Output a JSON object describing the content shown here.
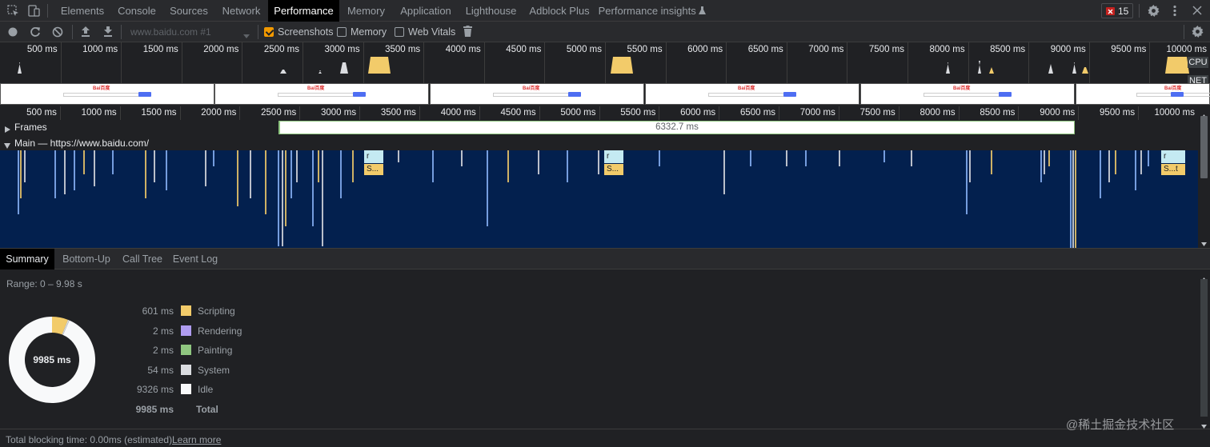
{
  "tabs": [
    "Elements",
    "Console",
    "Sources",
    "Network",
    "Performance",
    "Memory",
    "Application",
    "Lighthouse",
    "Adblock Plus",
    "Performance insights"
  ],
  "active_tab": "Performance",
  "error_count": "15",
  "toolbar": {
    "target": "www.baidu.com #1",
    "screenshots_label": "Screenshots",
    "memory_label": "Memory",
    "webvitals_label": "Web Vitals",
    "screenshots_checked": true
  },
  "overview": {
    "ticks": [
      "500 ms",
      "1000 ms",
      "1500 ms",
      "2000 ms",
      "2500 ms",
      "3000 ms",
      "3500 ms",
      "4000 ms",
      "4500 ms",
      "5000 ms",
      "5500 ms",
      "6000 ms",
      "6500 ms",
      "7000 ms",
      "7500 ms",
      "8000 ms",
      "8500 ms",
      "9000 ms",
      "9500 ms",
      "10000 ms"
    ],
    "cpu_label": "CPU",
    "net_label": "NET",
    "screenshot_logo": "Bai百度"
  },
  "timeline": {
    "frames_label": "Frames",
    "frame_duration": "6332.7 ms",
    "main_label": "Main — https://www.baidu.com/",
    "block_labels": [
      "r",
      "S...",
      "r",
      "S...",
      "r",
      "S...t"
    ]
  },
  "bottom_tabs": [
    "Summary",
    "Bottom-Up",
    "Call Tree",
    "Event Log"
  ],
  "active_bottom_tab": "Summary",
  "summary": {
    "range": "Range: 0 – 9.98 s",
    "total_center": "9985 ms",
    "rows": [
      {
        "value": "601 ms",
        "label": "Scripting",
        "color": "#f2cb6a"
      },
      {
        "value": "2 ms",
        "label": "Rendering",
        "color": "#af9cf0"
      },
      {
        "value": "2 ms",
        "label": "Painting",
        "color": "#8fc680"
      },
      {
        "value": "54 ms",
        "label": "System",
        "color": "#dadce0"
      },
      {
        "value": "9326 ms",
        "label": "Idle",
        "color": "#f8f9fa"
      },
      {
        "value": "9985 ms",
        "label": "Total",
        "color": ""
      }
    ],
    "donut": [
      {
        "label": "Idle",
        "value": 9326,
        "color": "#f8f9fa"
      },
      {
        "label": "Scripting",
        "value": 601,
        "color": "#f2cb6a"
      },
      {
        "label": "System",
        "value": 54,
        "color": "#dadce0"
      },
      {
        "label": "Rendering",
        "value": 2,
        "color": "#af9cf0"
      },
      {
        "label": "Painting",
        "value": 2,
        "color": "#8fc680"
      }
    ]
  },
  "status": {
    "text": "Total blocking time: 0.00ms (estimated)",
    "link": "Learn more",
    "watermark": "@稀土掘金技术社区"
  },
  "colors": {
    "flame_bg": "#03204e",
    "scripting": "#f2cb6a",
    "error_badge": "#c5221f"
  }
}
